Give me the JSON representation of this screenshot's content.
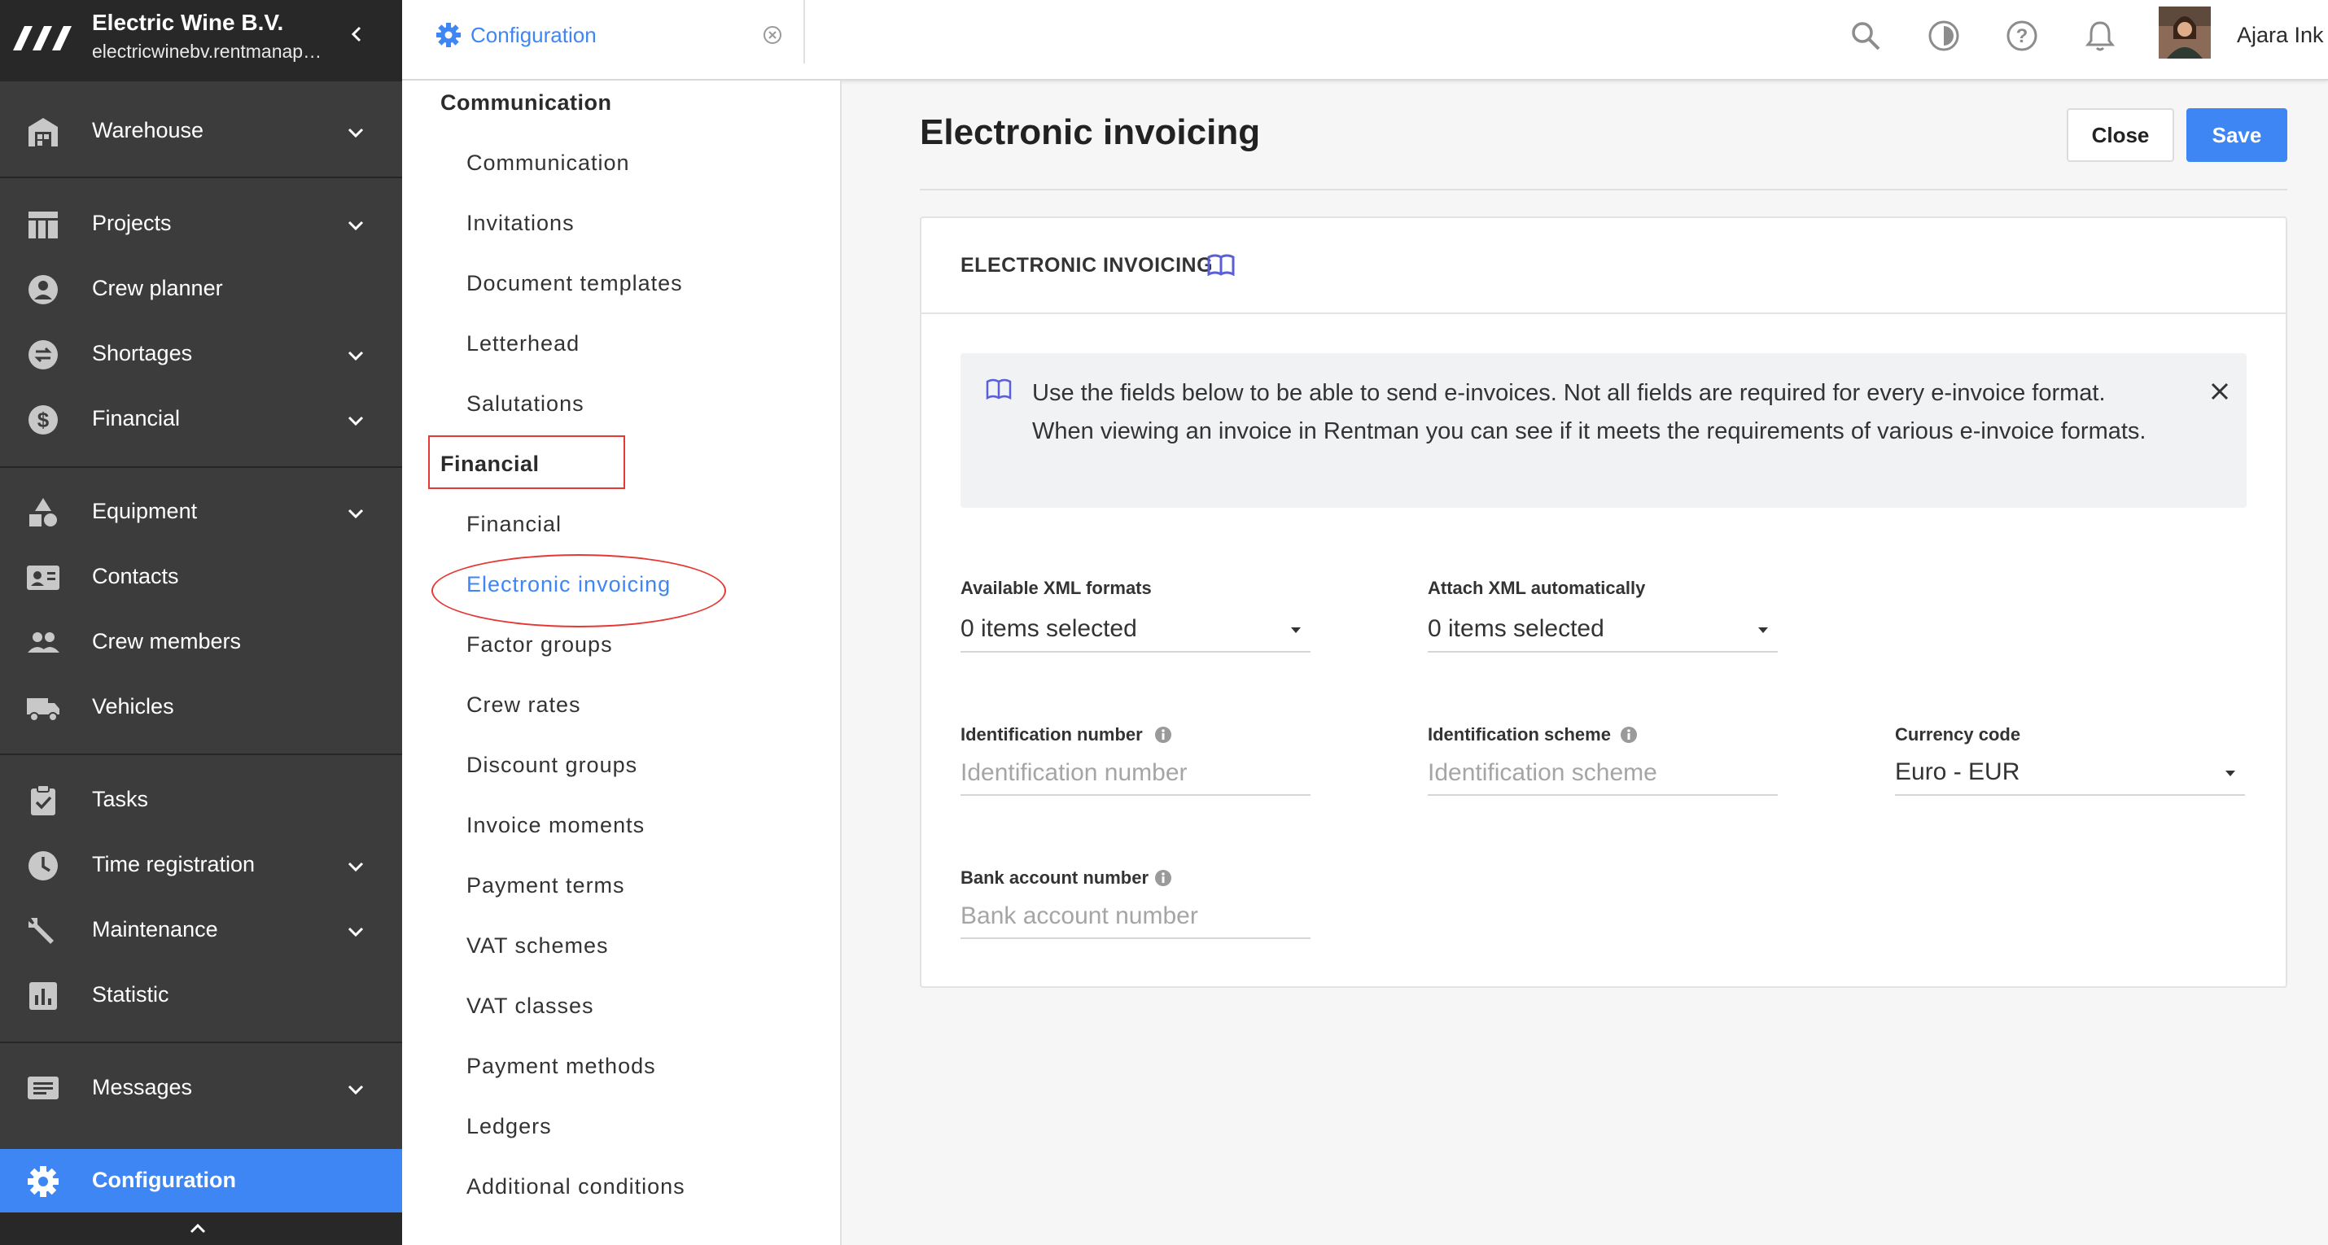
{
  "app": {
    "company": "Electric Wine B.V.",
    "domain": "electricwinebv.rentmanap…"
  },
  "sidebar": {
    "items": [
      {
        "label": "Warehouse",
        "icon": "warehouse-icon"
      },
      {
        "label": "Projects",
        "icon": "projects-icon"
      },
      {
        "label": "Crew planner",
        "icon": "crew-planner-icon"
      },
      {
        "label": "Shortages",
        "icon": "shortages-icon"
      },
      {
        "label": "Financial",
        "icon": "dollar-icon"
      },
      {
        "label": "Equipment",
        "icon": "equipment-icon"
      },
      {
        "label": "Contacts",
        "icon": "contacts-icon"
      },
      {
        "label": "Crew members",
        "icon": "crew-members-icon"
      },
      {
        "label": "Vehicles",
        "icon": "truck-icon"
      },
      {
        "label": "Tasks",
        "icon": "clipboard-icon"
      },
      {
        "label": "Time registration",
        "icon": "clock-icon"
      },
      {
        "label": "Maintenance",
        "icon": "wrench-icon"
      },
      {
        "label": "Statistic",
        "icon": "statistic-icon"
      },
      {
        "label": "Messages",
        "icon": "messages-icon"
      },
      {
        "label": "Configuration",
        "icon": "gear-icon"
      }
    ]
  },
  "topbar": {
    "tab_label": "Configuration",
    "user_name": "Ajara Ink"
  },
  "subnav": {
    "sections": [
      {
        "heading": "Communication",
        "items": [
          "Communication",
          "Invitations",
          "Document templates",
          "Letterhead",
          "Salutations"
        ]
      },
      {
        "heading": "Financial",
        "items": [
          "Financial",
          "Electronic invoicing",
          "Factor groups",
          "Crew rates",
          "Discount groups",
          "Invoice moments",
          "Payment terms",
          "VAT schemes",
          "VAT classes",
          "Payment methods",
          "Ledgers",
          "Additional conditions"
        ]
      }
    ],
    "active_item": "Electronic invoicing"
  },
  "main": {
    "title": "Electronic invoicing",
    "close_label": "Close",
    "save_label": "Save",
    "card_title": "ELECTRONIC INVOICING",
    "notice": "Use the fields below to be able to send e-invoices. Not all fields are required for every e-invoice format. When viewing an invoice in Rentman you can see if it meets the requirements of various e-invoice formats.",
    "fields": {
      "xml_formats": {
        "label": "Available XML formats",
        "value": "0 items selected"
      },
      "attach_xml": {
        "label": "Attach XML automatically",
        "value": "0 items selected"
      },
      "identification_number": {
        "label": "Identification number",
        "placeholder": "Identification number"
      },
      "identification_scheme": {
        "label": "Identification scheme",
        "placeholder": "Identification scheme"
      },
      "currency_code": {
        "label": "Currency code",
        "value": "Euro - EUR"
      },
      "bank_account": {
        "label": "Bank account number",
        "placeholder": "Bank account number"
      }
    }
  },
  "colors": {
    "accent": "#3f86f5",
    "sidebar_bg": "#3c3c3c",
    "highlight_annotation": "#e53935"
  }
}
